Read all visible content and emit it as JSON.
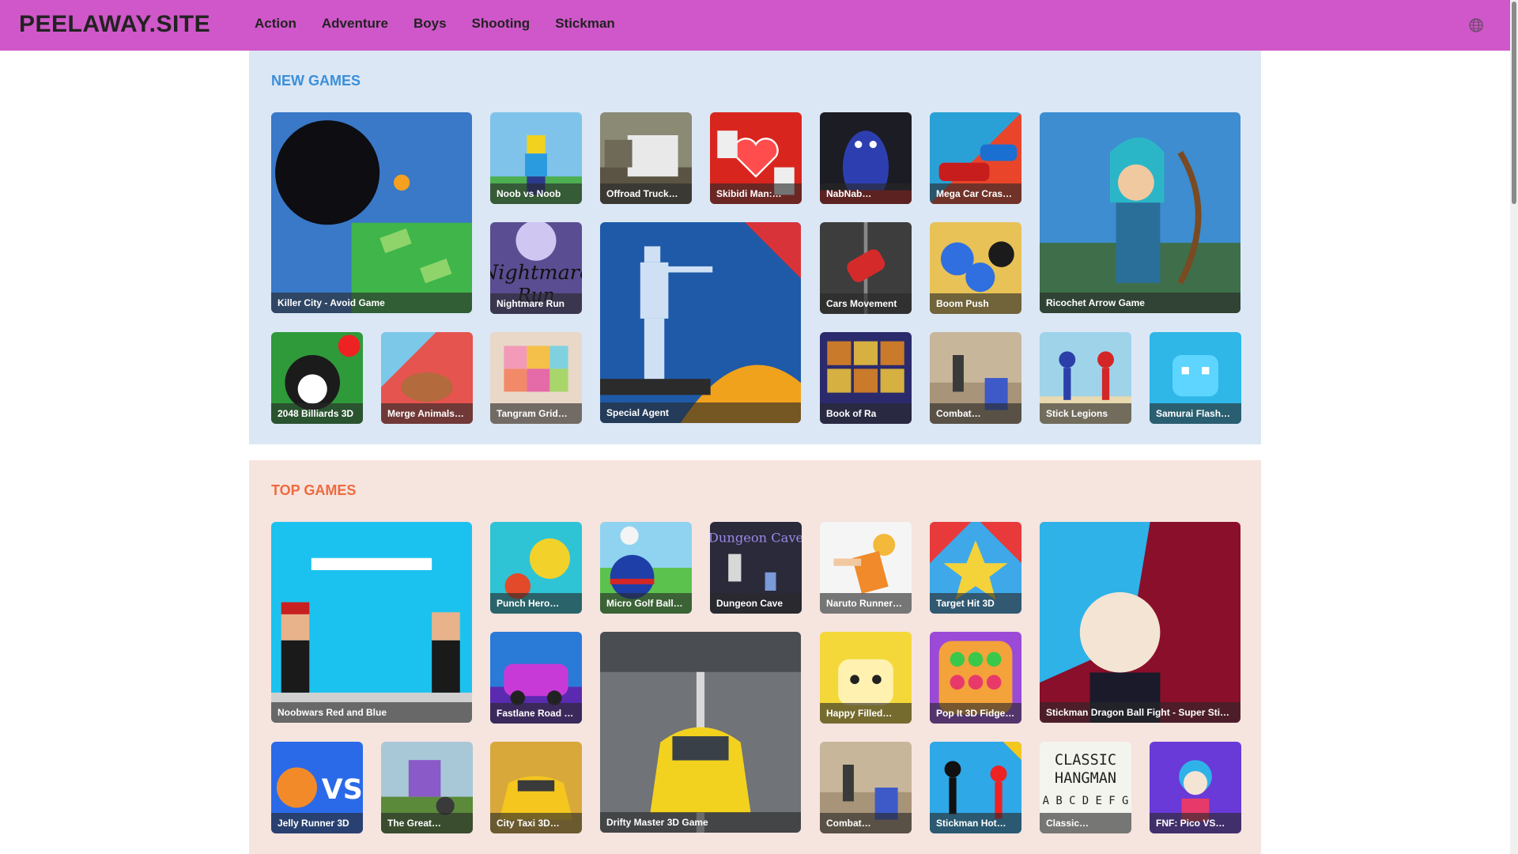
{
  "site": {
    "logo": "PEELAWAY.SITE"
  },
  "nav": [
    "Action",
    "Adventure",
    "Boys",
    "Shooting",
    "Stickman"
  ],
  "colors": {
    "header": "#cf57c9",
    "new_section_bg": "#dbe7f5",
    "top_section_bg": "#f6e4df",
    "new_title": "#3b8fd9",
    "top_title": "#ee6a3e"
  },
  "icons": {
    "language": "globe-icon"
  },
  "new_games": {
    "title": "NEW GAMES",
    "items": [
      "Killer City - Avoid Game",
      "Noob vs Noob",
      "Offroad Truck…",
      "Skibidi Man:…",
      "NabNab…",
      "Mega Car Cras…",
      "Ricochet Arrow Game",
      "Nightmare Run",
      "Special Agent",
      "Cars Movement",
      "Boom Push",
      "2048 Billiards 3D",
      "Merge Animals…",
      "Tangram Grid…",
      "Book of Ra",
      "Combat…",
      "Stick Legions",
      "Samurai Flash…"
    ]
  },
  "top_games": {
    "title": "TOP GAMES",
    "items": [
      "Noobwars Red and Blue",
      "Punch Hero…",
      "Micro Golf Ball…",
      "Dungeon Cave",
      "Naruto Runner…",
      "Target Hit 3D",
      "Stickman Dragon Ball Fight - Super Stic…",
      "Fastlane Road …",
      "Drifty Master 3D Game",
      "Happy Filled…",
      "Pop It 3D Fidge…",
      "Jelly Runner 3D",
      "The Great…",
      "City Taxi 3D…",
      "Combat…",
      "Stickman Hot…",
      "Classic…",
      "FNF: Pico VS…"
    ]
  }
}
